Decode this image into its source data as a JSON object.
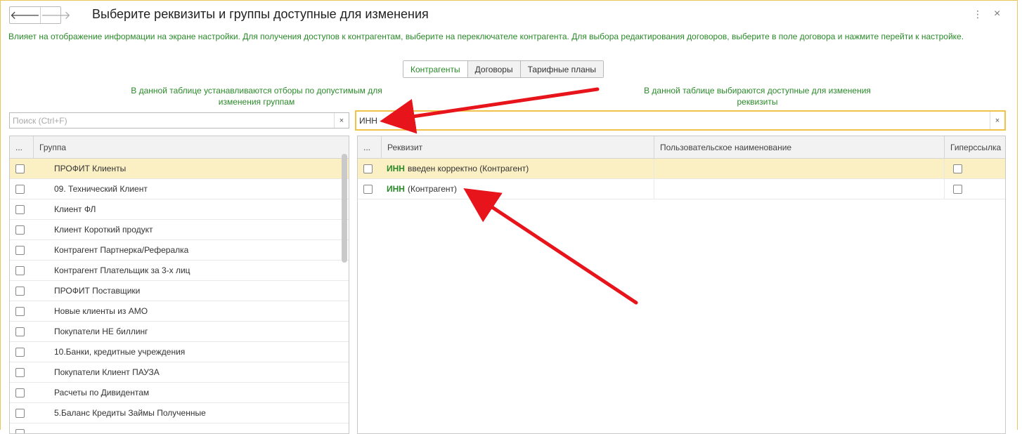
{
  "window": {
    "title": "Выберите реквизиты и группы доступные для изменения",
    "more_glyph": "⋮",
    "close_glyph": "×",
    "back_glyph": "🡐",
    "forward_glyph": "🡒"
  },
  "info_text": "Влияет на отображение информации на экране настройки. Для получения доступов к контрагентам, выберите на переключателе контрагента. Для выбора редактирования договоров, выберите в поле договора и нажмите перейти к настройке.",
  "tabs": [
    {
      "label": "Контрагенты",
      "active": true
    },
    {
      "label": "Договоры",
      "active": false
    },
    {
      "label": "Тарифные планы",
      "active": false
    }
  ],
  "left": {
    "hint": "В данной таблице устанавливаются отборы по допустимым для изменения групп",
    "hint_line2": "изменения группам",
    "search": {
      "placeholder": "Поиск (Ctrl+F)",
      "value": "",
      "clear_glyph": "×"
    },
    "columns": [
      "...",
      "Группа"
    ],
    "rows": [
      "ПРОФИТ Клиенты",
      "09. Технический Клиент",
      "Клиент ФЛ",
      "Клиент Короткий продукт",
      "Контрагент Партнерка/Рефералка",
      "Контрагент Плательщик за 3-х лиц",
      "ПРОФИТ Поставщики",
      "Новые клиенты из АМО",
      "Покупатели НЕ биллинг",
      "10.Банки, кредитные учреждения",
      "Покупатели Клиент ПАУЗА",
      "Расчеты по Дивидентам",
      "5.Баланс Кредиты Займы Полученные",
      ""
    ]
  },
  "right": {
    "hint_line1": "В данной таблице выбираются доступные для изменения",
    "hint_line2": "реквизиты",
    "search": {
      "value": "ИНН",
      "clear_glyph": "×"
    },
    "columns": [
      "...",
      "Реквизит",
      "Пользовательское наименование",
      "Гиперссылка"
    ],
    "rows": [
      {
        "match": "ИНН",
        "rest": "введен корректно (Контрагент)"
      },
      {
        "match": "ИНН",
        "rest": "(Контрагент)"
      }
    ]
  },
  "colors": {
    "accent": "#2a8a2a",
    "selection": "#fbefc4",
    "focus": "#f0c24a",
    "arrow": "#e8141b"
  }
}
